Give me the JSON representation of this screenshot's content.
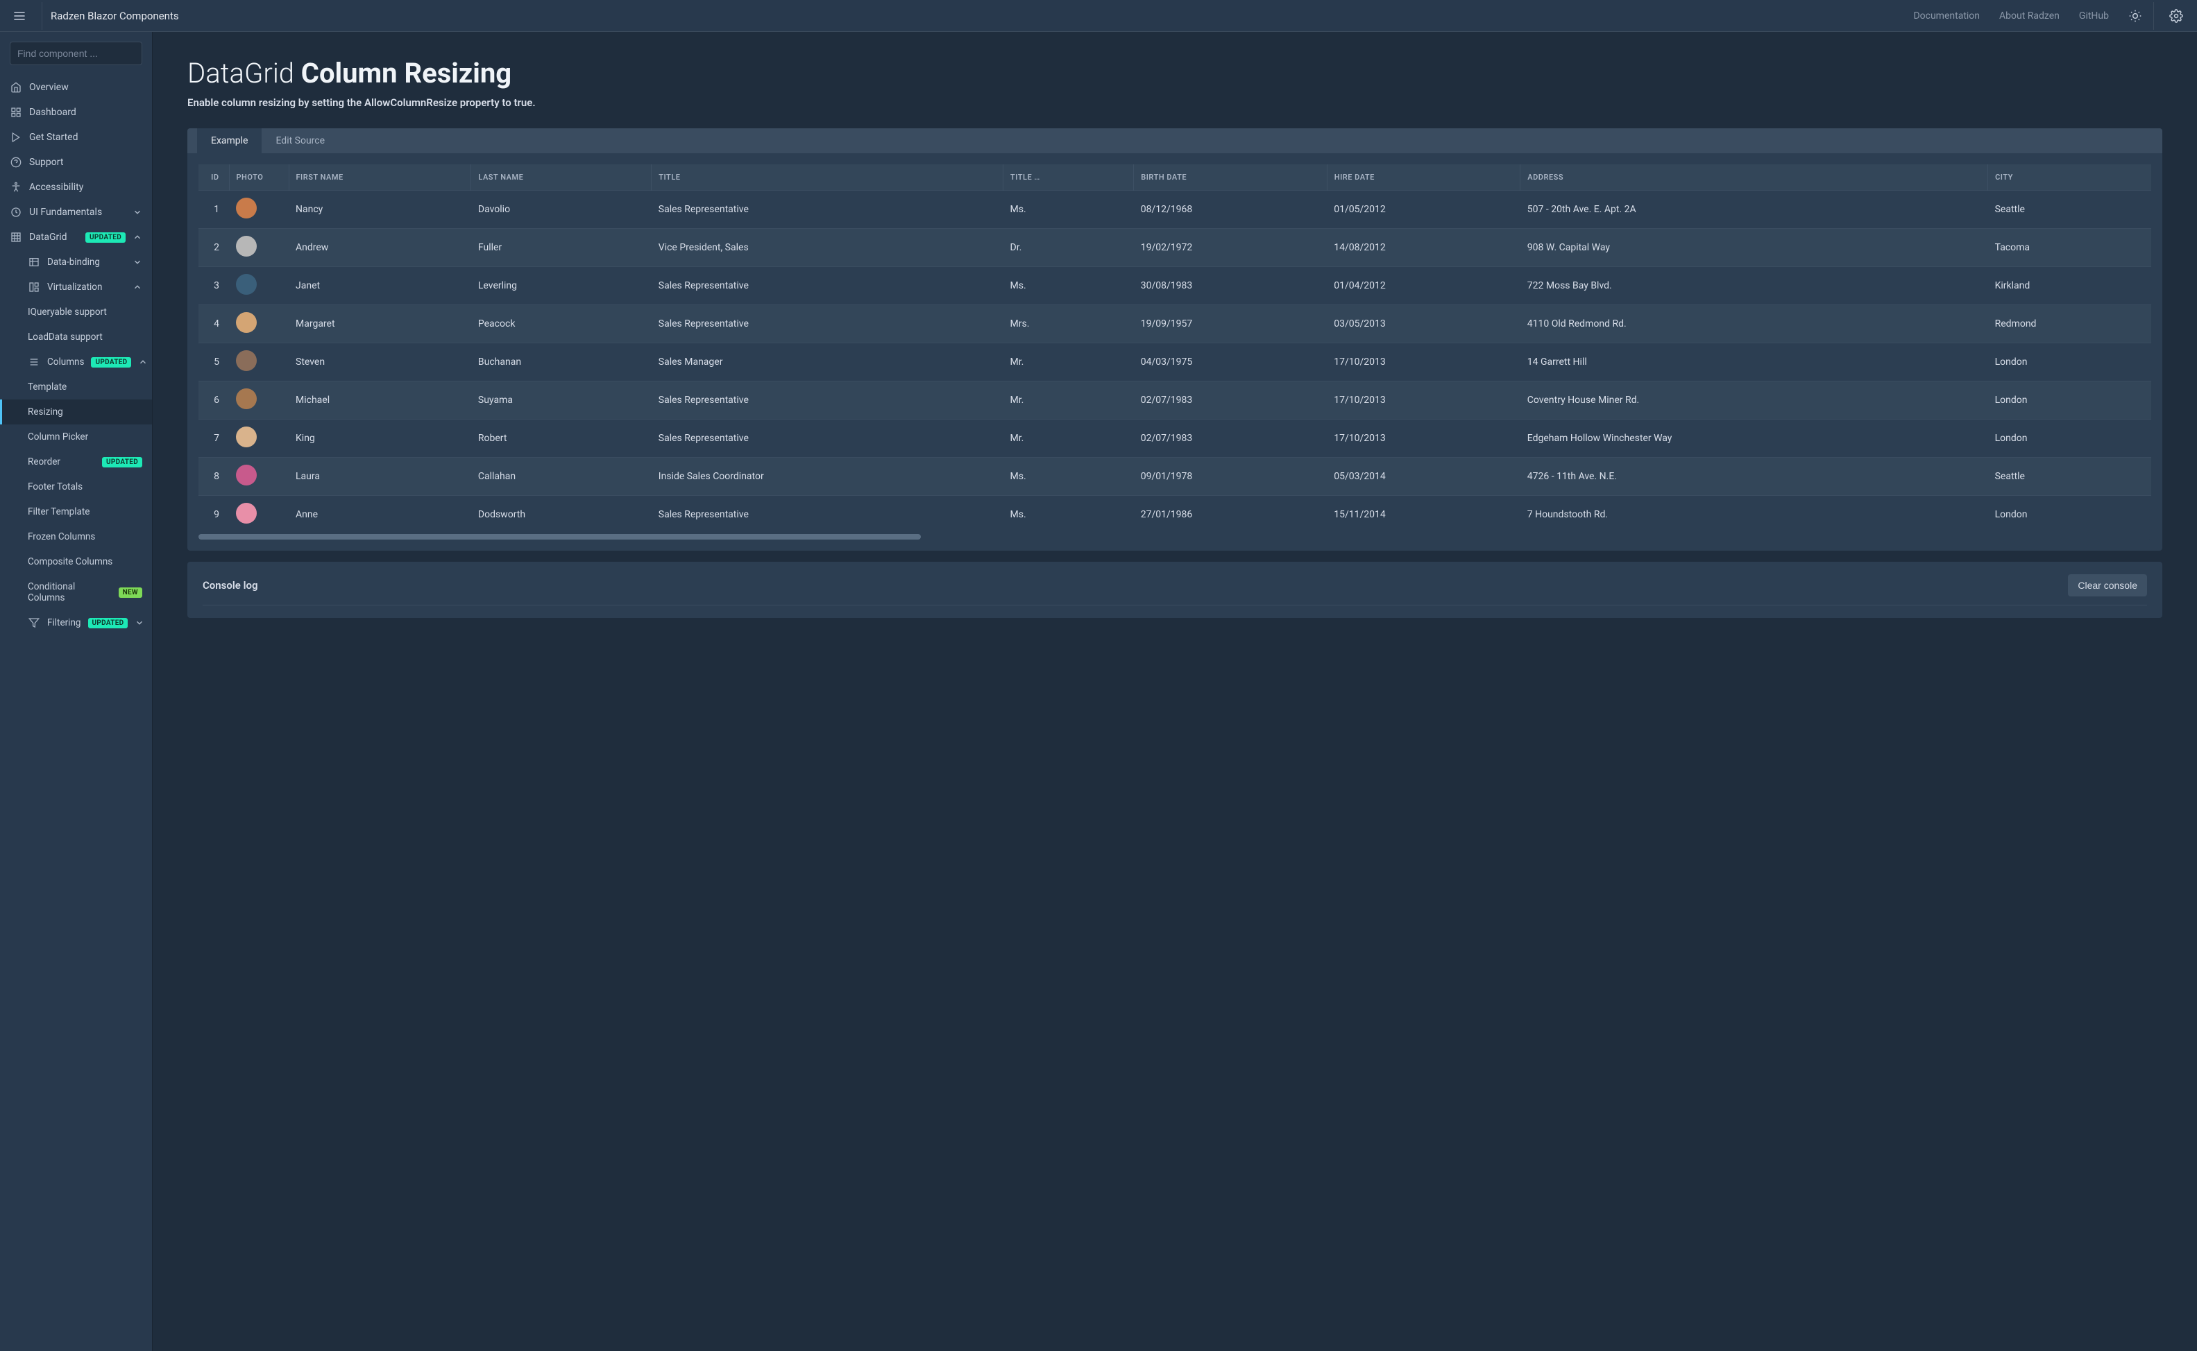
{
  "header": {
    "brand": "Radzen Blazor Components",
    "links": [
      "Documentation",
      "About Radzen",
      "GitHub"
    ]
  },
  "sidebar": {
    "search_placeholder": "Find component ...",
    "items": [
      {
        "icon": "home",
        "label": "Overview"
      },
      {
        "icon": "dashboard",
        "label": "Dashboard"
      },
      {
        "icon": "play",
        "label": "Get Started"
      },
      {
        "icon": "help",
        "label": "Support"
      },
      {
        "icon": "accessibility",
        "label": "Accessibility"
      },
      {
        "icon": "layers",
        "label": "UI Fundamentals",
        "expandable": true,
        "expanded": false
      },
      {
        "icon": "grid",
        "label": "DataGrid",
        "badge": "UPDATED",
        "badge_type": "updated",
        "expandable": true,
        "expanded": true
      },
      {
        "icon": "table",
        "label": "Data-binding",
        "expandable": true,
        "expanded": false,
        "sub": true
      },
      {
        "icon": "virtualization",
        "label": "Virtualization",
        "expandable": true,
        "expanded": true,
        "sub": true
      },
      {
        "label": "IQueryable support",
        "sub2": true
      },
      {
        "label": "LoadData support",
        "sub2": true
      },
      {
        "icon": "columns",
        "label": "Columns",
        "badge": "UPDATED",
        "badge_type": "updated",
        "expandable": true,
        "expanded": true,
        "sub": true
      },
      {
        "label": "Template",
        "sub2": true
      },
      {
        "label": "Resizing",
        "sub2": true,
        "active": true
      },
      {
        "label": "Column Picker",
        "sub2": true
      },
      {
        "label": "Reorder",
        "badge": "UPDATED",
        "badge_type": "updated",
        "sub2": true
      },
      {
        "label": "Footer Totals",
        "sub2": true
      },
      {
        "label": "Filter Template",
        "sub2": true
      },
      {
        "label": "Frozen Columns",
        "sub2": true
      },
      {
        "label": "Composite Columns",
        "sub2": true
      },
      {
        "label": "Conditional Columns",
        "badge": "NEW",
        "badge_type": "new",
        "sub2": true
      },
      {
        "icon": "filter",
        "label": "Filtering",
        "badge": "UPDATED",
        "badge_type": "updated",
        "expandable": true,
        "expanded": false,
        "sub": true
      }
    ]
  },
  "page": {
    "title_thin": "DataGrid ",
    "title_bold": "Column Resizing",
    "subtitle": "Enable column resizing by setting the AllowColumnResize property to true.",
    "tabs": [
      "Example",
      "Edit Source"
    ],
    "active_tab": 0
  },
  "grid": {
    "columns": [
      "ID",
      "PHOTO",
      "FIRST NAME",
      "LAST NAME",
      "TITLE",
      "TITLE …",
      "BIRTH DATE",
      "HIRE DATE",
      "ADDRESS",
      "CITY"
    ],
    "rows": [
      {
        "id": "1",
        "avatar": "#c97b4a",
        "first": "Nancy",
        "last": "Davolio",
        "title": "Sales Representative",
        "toc": "Ms.",
        "birth": "08/12/1968",
        "hire": "01/05/2012",
        "address": "507 - 20th Ave. E. Apt. 2A",
        "city": "Seattle"
      },
      {
        "id": "2",
        "avatar": "#b7b7b7",
        "first": "Andrew",
        "last": "Fuller",
        "title": "Vice President, Sales",
        "toc": "Dr.",
        "birth": "19/02/1972",
        "hire": "14/08/2012",
        "address": "908 W. Capital Way",
        "city": "Tacoma"
      },
      {
        "id": "3",
        "avatar": "#3a5f7a",
        "first": "Janet",
        "last": "Leverling",
        "title": "Sales Representative",
        "toc": "Ms.",
        "birth": "30/08/1983",
        "hire": "01/04/2012",
        "address": "722 Moss Bay Blvd.",
        "city": "Kirkland"
      },
      {
        "id": "4",
        "avatar": "#d4a574",
        "first": "Margaret",
        "last": "Peacock",
        "title": "Sales Representative",
        "toc": "Mrs.",
        "birth": "19/09/1957",
        "hire": "03/05/2013",
        "address": "4110 Old Redmond Rd.",
        "city": "Redmond"
      },
      {
        "id": "5",
        "avatar": "#8a6d5a",
        "first": "Steven",
        "last": "Buchanan",
        "title": "Sales Manager",
        "toc": "Mr.",
        "birth": "04/03/1975",
        "hire": "17/10/2013",
        "address": "14 Garrett Hill",
        "city": "London"
      },
      {
        "id": "6",
        "avatar": "#a67850",
        "first": "Michael",
        "last": "Suyama",
        "title": "Sales Representative",
        "toc": "Mr.",
        "birth": "02/07/1983",
        "hire": "17/10/2013",
        "address": "Coventry House Miner Rd.",
        "city": "London"
      },
      {
        "id": "7",
        "avatar": "#d9b38c",
        "first": "King",
        "last": "Robert",
        "title": "Sales Representative",
        "toc": "Mr.",
        "birth": "02/07/1983",
        "hire": "17/10/2013",
        "address": "Edgeham Hollow Winchester Way",
        "city": "London"
      },
      {
        "id": "8",
        "avatar": "#c85a8c",
        "first": "Laura",
        "last": "Callahan",
        "title": "Inside Sales Coordinator",
        "toc": "Ms.",
        "birth": "09/01/1978",
        "hire": "05/03/2014",
        "address": "4726 - 11th Ave. N.E.",
        "city": "Seattle"
      },
      {
        "id": "9",
        "avatar": "#e88fa8",
        "first": "Anne",
        "last": "Dodsworth",
        "title": "Sales Representative",
        "toc": "Ms.",
        "birth": "27/01/1986",
        "hire": "15/11/2014",
        "address": "7 Houndstooth Rd.",
        "city": "London"
      }
    ]
  },
  "console": {
    "title": "Console log",
    "clear_label": "Clear console"
  }
}
